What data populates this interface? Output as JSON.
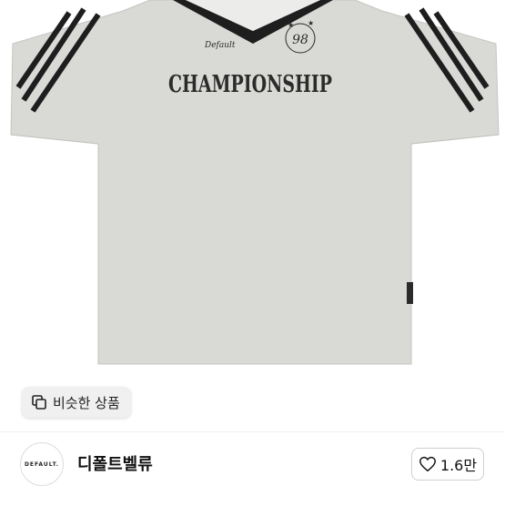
{
  "product_image": {
    "jersey_text": "CHAMPIONSHIP",
    "brand_script": "Default",
    "badge_text": "98"
  },
  "similar_button": {
    "label": "비슷한 상품",
    "icon": "copy-icon"
  },
  "shop": {
    "avatar_text": "DEFAULT.",
    "name": "디폴트벨류"
  },
  "like_button": {
    "icon": "heart-icon",
    "count": "1.6만"
  },
  "colors": {
    "shirt": "#d9dad6",
    "stripe": "#1e1e1e",
    "print": "#2b2b2b"
  }
}
